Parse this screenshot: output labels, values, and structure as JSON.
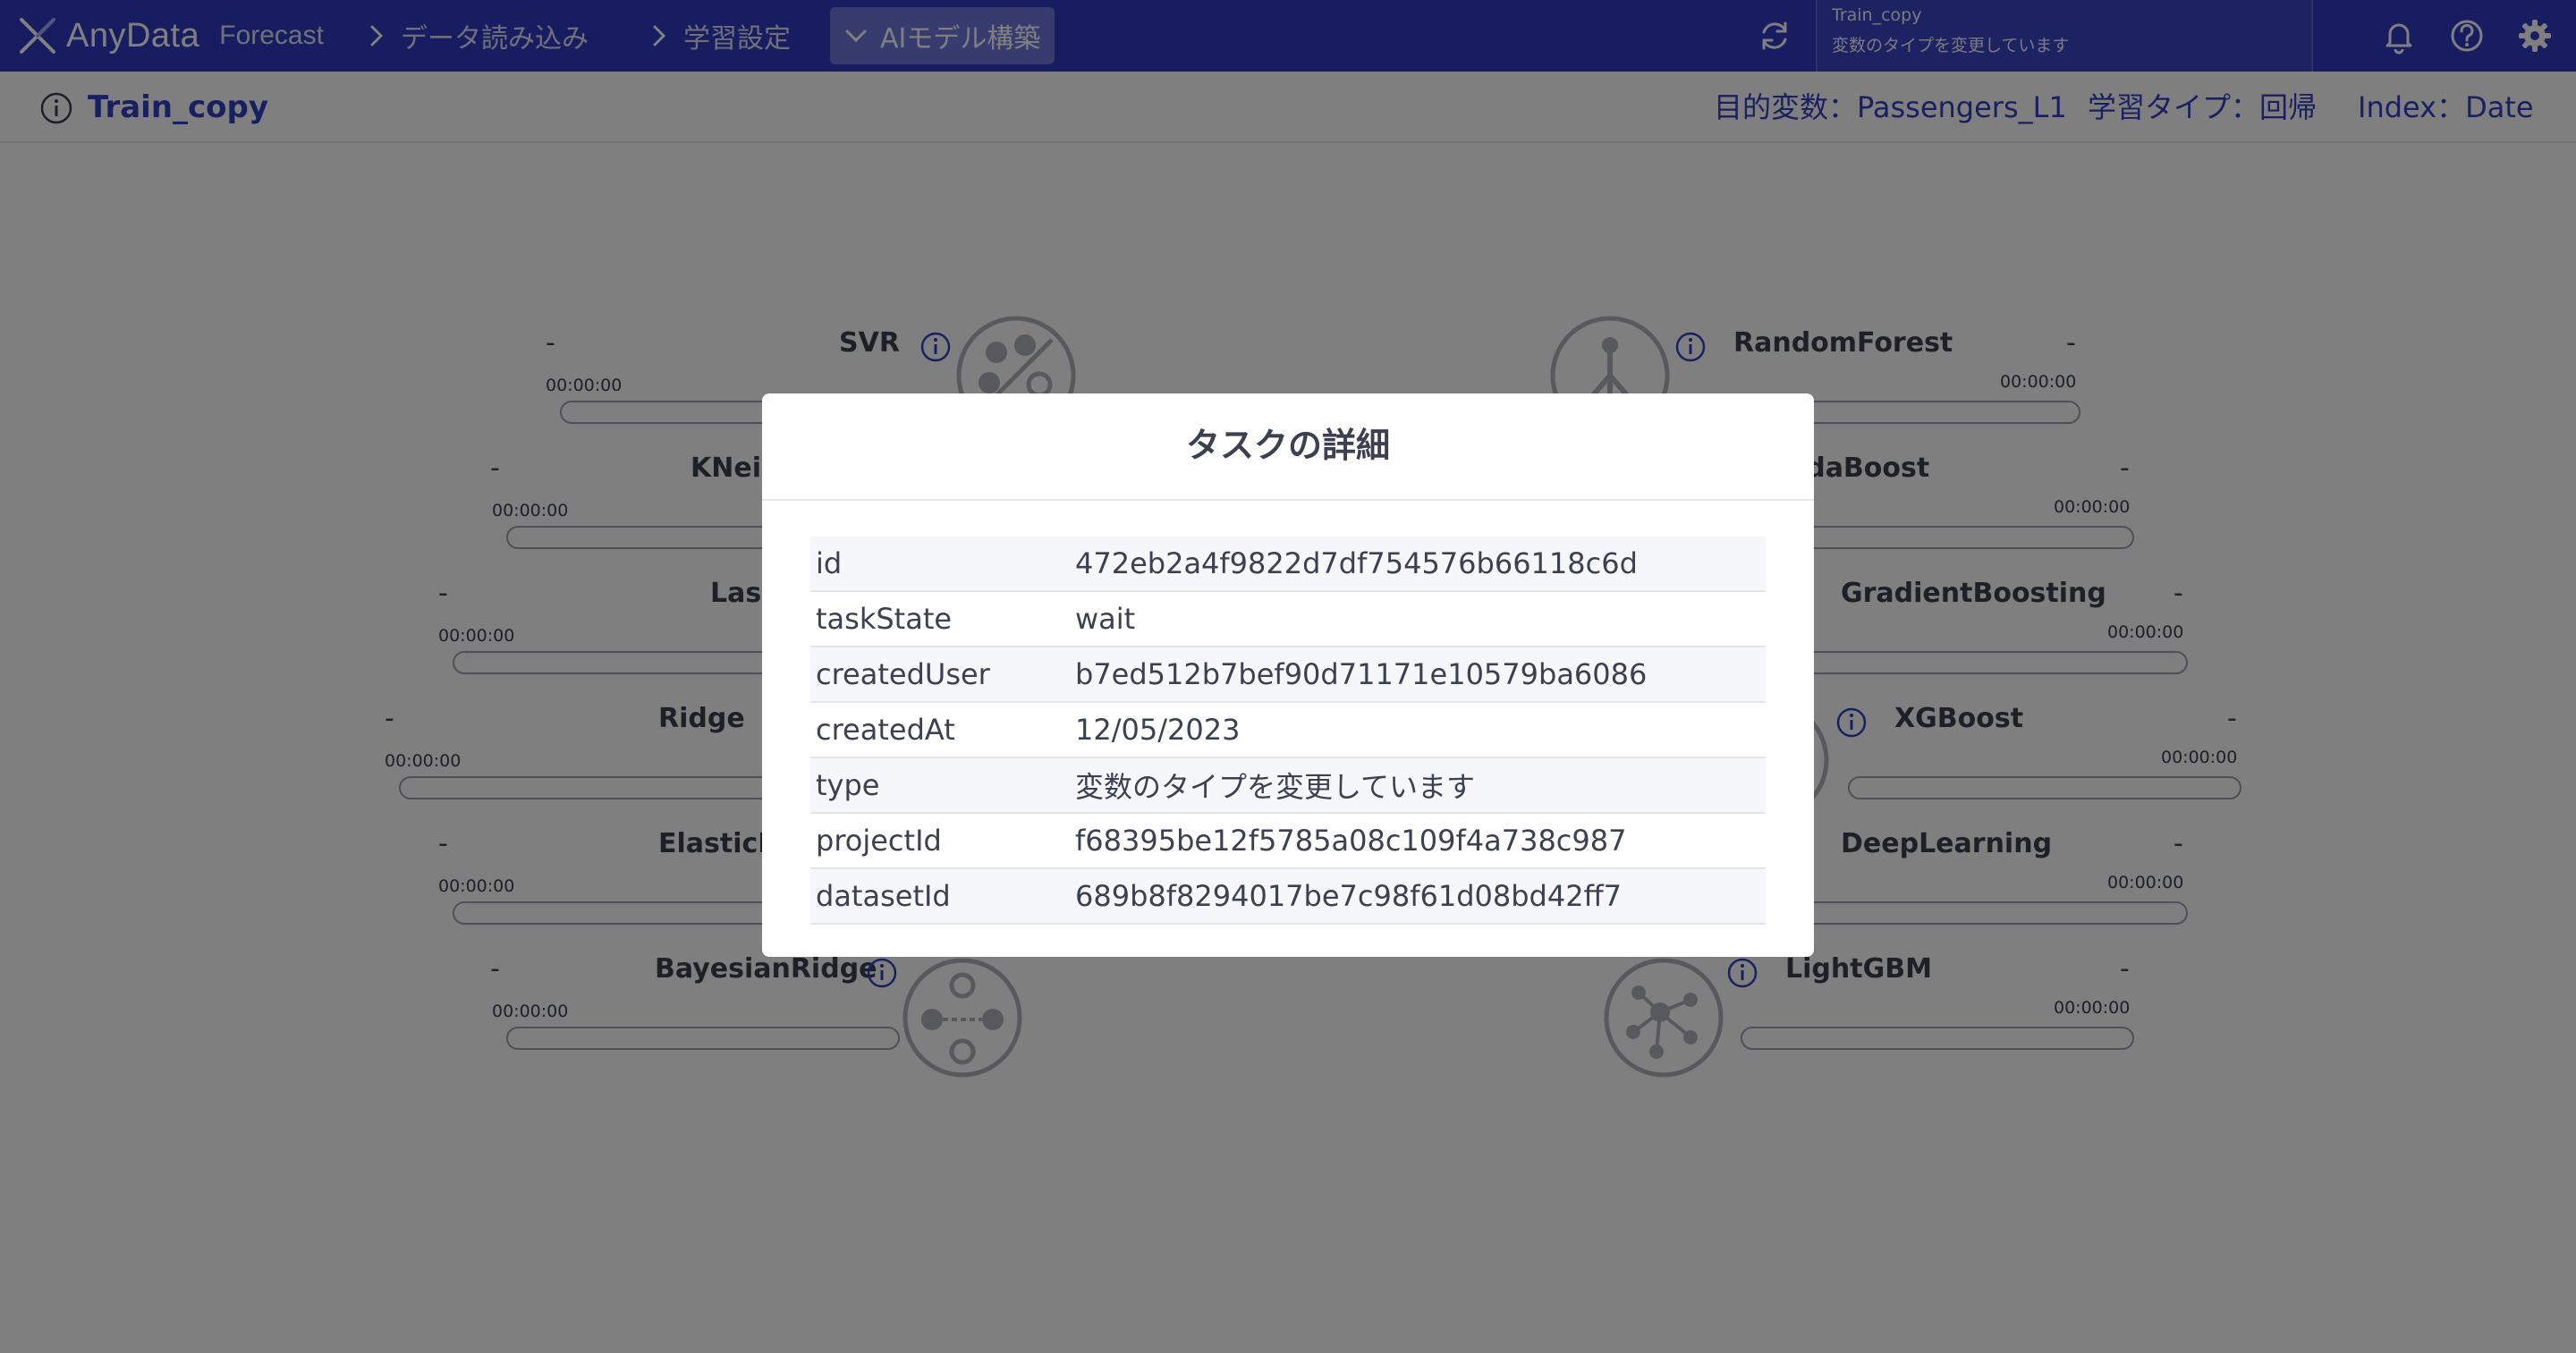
{
  "header": {
    "brand": "AnyData",
    "product": "Forecast",
    "steps": [
      {
        "label": "データ読み込み",
        "active": false
      },
      {
        "label": "学習設定",
        "active": false
      },
      {
        "label": "AIモデル構築",
        "active": true
      }
    ],
    "task_panel": {
      "title": "Train_copy",
      "message": "変数のタイプを変更しています"
    }
  },
  "subheader": {
    "title": "Train_copy",
    "target_label": "目的変数：",
    "target_value": "Passengers_L1",
    "learning_type_label": "学習タイプ：",
    "learning_type_value": "回帰",
    "index_label": "Index：",
    "index_value": "Date"
  },
  "models_left": [
    {
      "name": "SVR",
      "score": "-",
      "time": "00:00:00",
      "progress": 0,
      "emblem": "svr-icon"
    },
    {
      "name": "KNeighbors",
      "score": "-",
      "time": "00:00:00",
      "progress": 0,
      "emblem": ""
    },
    {
      "name": "Lasso",
      "score": "-",
      "time": "00:00:00",
      "progress": 0,
      "emblem": ""
    },
    {
      "name": "Ridge",
      "score": "-",
      "time": "00:00:00",
      "progress": 0,
      "emblem": ""
    },
    {
      "name": "ElasticNet",
      "score": "-",
      "time": "00:00:00",
      "progress": 0,
      "emblem": ""
    },
    {
      "name": "BayesianRidge",
      "score": "-",
      "time": "00:00:00",
      "progress": 0,
      "emblem": "bayesian-icon"
    }
  ],
  "models_right": [
    {
      "name": "RandomForest",
      "score": "-",
      "time": "00:00:00",
      "progress": 0,
      "emblem": "tree-icon"
    },
    {
      "name": "AdaBoost",
      "score": "-",
      "time": "00:00:00",
      "progress": 0,
      "emblem": ""
    },
    {
      "name": "GradientBoosting",
      "score": "-",
      "time": "00:00:00",
      "progress": 0,
      "emblem": ""
    },
    {
      "name": "XGBoost",
      "score": "-",
      "time": "00:00:00",
      "progress": 0,
      "emblem": "xgboost-icon"
    },
    {
      "name": "DeepLearning",
      "score": "-",
      "time": "00:00:00",
      "progress": 0,
      "emblem": ""
    },
    {
      "name": "LightGBM",
      "score": "-",
      "time": "00:00:00",
      "progress": 0,
      "emblem": "network-icon"
    }
  ],
  "modal": {
    "title": "タスクの詳細",
    "rows": [
      {
        "key": "id",
        "value": "472eb2a4f9822d7df754576b66118c6d"
      },
      {
        "key": "taskState",
        "value": "wait"
      },
      {
        "key": "createdUser",
        "value": "b7ed512b7bef90d71171e10579ba6086"
      },
      {
        "key": "createdAt",
        "value": "12/05/2023"
      },
      {
        "key": "type",
        "value": "変数のタイプを変更しています"
      },
      {
        "key": "projectId",
        "value": "f68395be12f5785a08c109f4a738c987"
      },
      {
        "key": "datasetId",
        "value": "689b8f8294017be7c98f61d08bd42ff7"
      }
    ]
  },
  "colors": {
    "brand": "#2f3ac0",
    "accent_text": "#3340c2",
    "active_step": "#6e76dd",
    "overlay": "rgba(0,0,0,0.5)"
  }
}
